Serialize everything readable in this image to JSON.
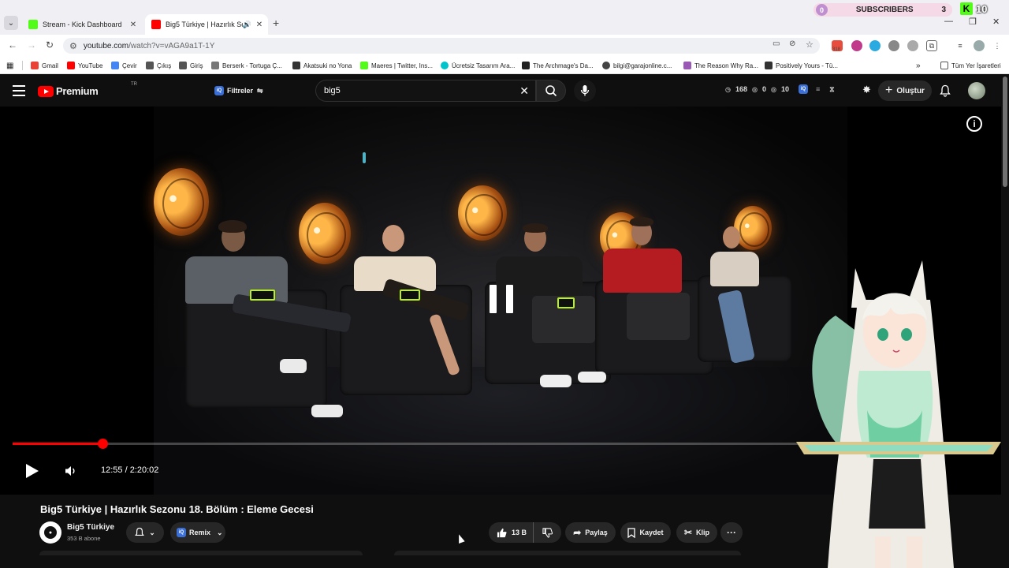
{
  "browser": {
    "tabs": [
      {
        "title": "Stream - Kick Dashboard",
        "active": false,
        "favicon_color": "#53fc18"
      },
      {
        "title": "Big5 Türkiye | Hazırlık Sezon",
        "active": true,
        "favicon_color": "#ff0000"
      }
    ],
    "url_host": "youtube.com",
    "url_path": "/watch?v=vAGA9a1T-1Y",
    "overlay": {
      "subscribers_label": "SUBSCRIBERS",
      "subscribers_left": "0",
      "subscribers_count": "3",
      "kick_count": "10"
    },
    "extension_badge": "318",
    "bookmarks": [
      {
        "label": "Gmail",
        "color": "#ea4335"
      },
      {
        "label": "YouTube",
        "color": "#ff0000"
      },
      {
        "label": "Çevir",
        "color": "#4285f4"
      },
      {
        "label": "Çıkış",
        "color": "#555555"
      },
      {
        "label": "Giriş",
        "color": "#555555"
      },
      {
        "label": "Berserk - Tortuga Ç...",
        "color": "#777777"
      },
      {
        "label": "Akatsuki no Yona",
        "color": "#333333"
      },
      {
        "label": "Maeres | Twitter, Ins...",
        "color": "#53fc18"
      },
      {
        "label": "Ücretsiz Tasarım Ara...",
        "color": "#00c4cc"
      },
      {
        "label": "The Archmage's Da...",
        "color": "#222222"
      },
      {
        "label": "bilgi@garajonline.c...",
        "color": "#444444"
      },
      {
        "label": "The Reason Why Ra...",
        "color": "#9b59b6"
      },
      {
        "label": "Positively Yours - Tü...",
        "color": "#333333"
      }
    ],
    "bookmarks_more": "»",
    "all_bookmarks": "Tüm Yer İşaretleri"
  },
  "youtube": {
    "logo_text": "Premium",
    "region": "TR",
    "filters_label": "Filtreler",
    "search_query": "big5",
    "stats": [
      "168",
      "0",
      "10"
    ],
    "create_label": "Oluştur",
    "iq_label": "iQ"
  },
  "player": {
    "current_time": "12:55",
    "duration": "2:20:02",
    "progress_fraction": 0.092,
    "state": "paused",
    "info_label": "i"
  },
  "video": {
    "title": "Big5 Türkiye | Hazırlık Sezonu 18. Bölüm : Eleme Gecesi",
    "channel_name": "Big5 Türkiye",
    "channel_subs": "353 B abone",
    "remix_label": "Remix",
    "likes": "13 B",
    "share_label": "Paylaş",
    "save_label": "Kaydet",
    "clip_label": "Klip",
    "more_label": "···"
  }
}
